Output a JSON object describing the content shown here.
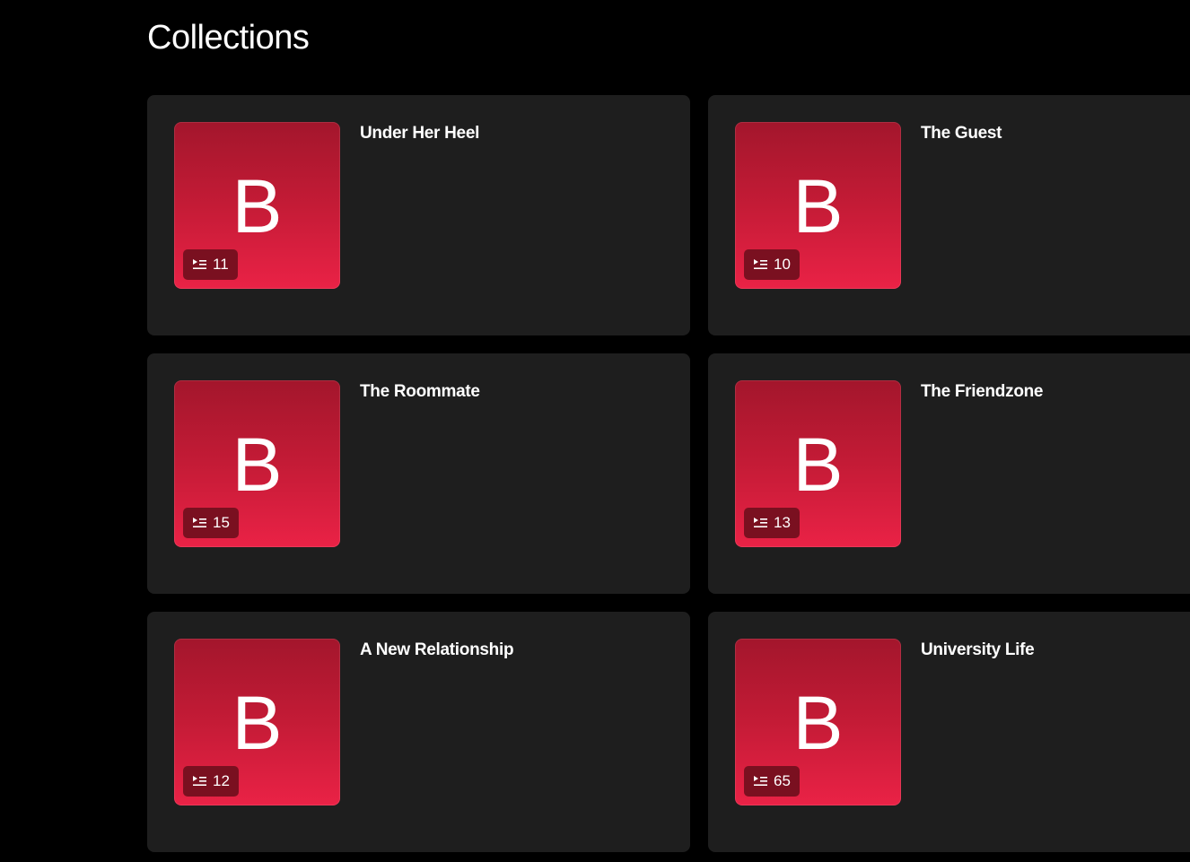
{
  "page": {
    "title": "Collections"
  },
  "collections": [
    {
      "title": "Under Her Heel",
      "letter": "B",
      "count": "11"
    },
    {
      "title": "The Guest",
      "letter": "B",
      "count": "10"
    },
    {
      "title": "The Roommate",
      "letter": "B",
      "count": "15"
    },
    {
      "title": "The Friendzone",
      "letter": "B",
      "count": "13"
    },
    {
      "title": "A New Relationship",
      "letter": "B",
      "count": "12"
    },
    {
      "title": "University Life",
      "letter": "B",
      "count": "65"
    }
  ],
  "icons": {
    "count": "playlist-icon"
  },
  "colors": {
    "background": "#000000",
    "card": "#1e1e1e",
    "thumb_top": "#a3162c",
    "thumb_bottom": "#ea2246",
    "badge": "#7a1020"
  }
}
